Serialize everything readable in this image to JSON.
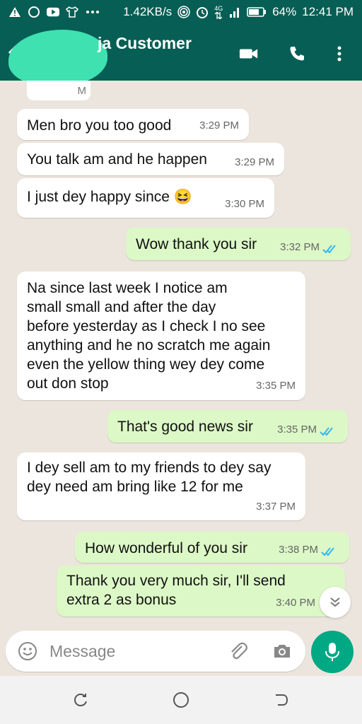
{
  "status_bar": {
    "network_speed": "1.42KB/s",
    "network_type": "4G",
    "battery": "64%",
    "time": "12:41 PM"
  },
  "header": {
    "contact_name_visible": "ja Customer",
    "icons": [
      "back-arrow-icon",
      "video-call-icon",
      "phone-icon",
      "more-options-icon"
    ]
  },
  "partial_timestamp": "M",
  "messages": [
    {
      "dir": "in",
      "text": [
        "Men bro you too good"
      ],
      "time": "3:29 PM"
    },
    {
      "dir": "in",
      "text": [
        "You talk am and he happen"
      ],
      "time": "3:29 PM"
    },
    {
      "dir": "in",
      "text": [
        "I just dey happy since 😆"
      ],
      "time": "3:30 PM"
    },
    {
      "dir": "out",
      "text": [
        "Wow thank you sir"
      ],
      "time": "3:32 PM",
      "status": "read"
    },
    {
      "dir": "in",
      "text": [
        "Na since last week I notice am",
        "small small and after the day",
        "before yesterday as I check I no see",
        "anything and he no scratch me again",
        "even the yellow thing wey dey come",
        "out don stop"
      ],
      "time": "3:35 PM"
    },
    {
      "dir": "out",
      "text": [
        "That's good news sir"
      ],
      "time": "3:35 PM",
      "status": "read"
    },
    {
      "dir": "in",
      "text": [
        "I dey sell am to my friends to dey say",
        "dey need am bring like 12 for me"
      ],
      "time": "3:37 PM"
    },
    {
      "dir": "out",
      "text": [
        "How wonderful of you sir"
      ],
      "time": "3:38 PM",
      "status": "read"
    },
    {
      "dir": "out",
      "text": [
        "Thank you very much sir, I'll send",
        "extra 2 as bonus"
      ],
      "time": "3:40 PM"
    }
  ],
  "composer": {
    "placeholder": "Message",
    "icons": [
      "emoji-icon",
      "attachment-icon",
      "camera-icon",
      "mic-icon"
    ]
  },
  "colors": {
    "header": "#075e54",
    "outgoing_bubble": "#dcf8c6",
    "incoming_bubble": "#ffffff",
    "chat_bg": "#ece5dd",
    "read_ticks": "#34b7f1",
    "mic_button": "#00a884"
  }
}
